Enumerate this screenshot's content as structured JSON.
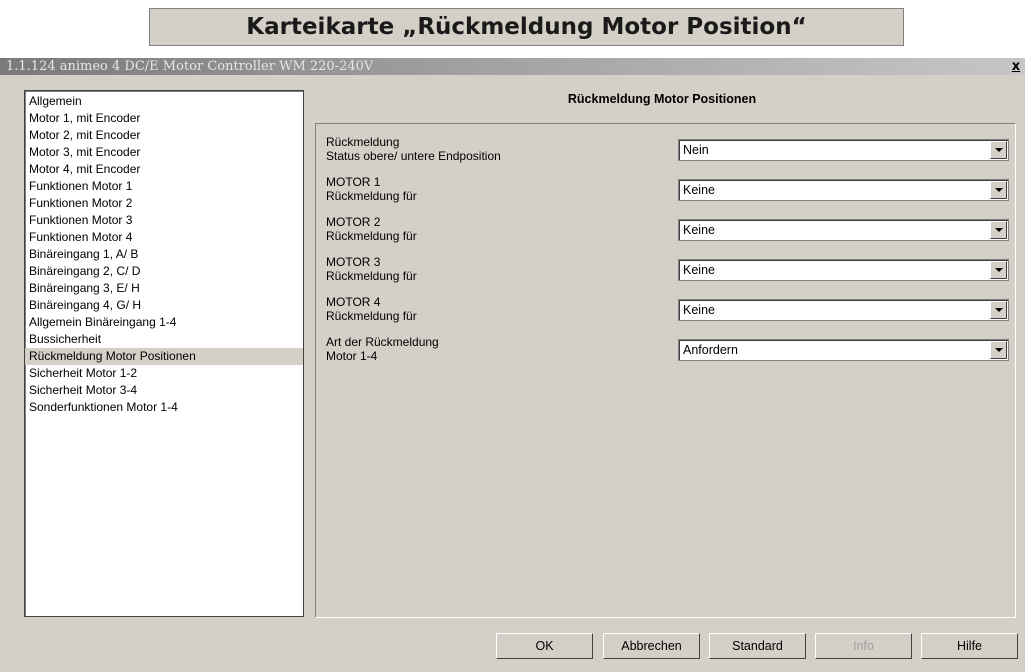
{
  "doc_heading": "Karteikarte „Rückmeldung Motor Position“",
  "window": {
    "title": "1.1.124 animeo 4 DC/E Motor Controller WM 220-240V",
    "close_label": "x"
  },
  "nav": {
    "items": [
      {
        "label": "Allgemein",
        "selected": false
      },
      {
        "label": "Motor 1, mit Encoder",
        "selected": false
      },
      {
        "label": "Motor 2, mit Encoder",
        "selected": false
      },
      {
        "label": "Motor 3, mit Encoder",
        "selected": false
      },
      {
        "label": "Motor 4, mit Encoder",
        "selected": false
      },
      {
        "label": "Funktionen Motor 1",
        "selected": false
      },
      {
        "label": "Funktionen Motor 2",
        "selected": false
      },
      {
        "label": "Funktionen Motor 3",
        "selected": false
      },
      {
        "label": "Funktionen Motor 4",
        "selected": false
      },
      {
        "label": "Binäreingang 1, A/ B",
        "selected": false
      },
      {
        "label": "Binäreingang 2, C/ D",
        "selected": false
      },
      {
        "label": "Binäreingang 3, E/ H",
        "selected": false
      },
      {
        "label": "Binäreingang 4, G/ H",
        "selected": false
      },
      {
        "label": "Allgemein Binäreingang 1-4",
        "selected": false
      },
      {
        "label": "Bussicherheit",
        "selected": false
      },
      {
        "label": "Rückmeldung Motor Positionen",
        "selected": true
      },
      {
        "label": "Sicherheit Motor 1-2",
        "selected": false
      },
      {
        "label": "Sicherheit Motor 3-4",
        "selected": false
      },
      {
        "label": "Sonderfunktionen Motor 1-4",
        "selected": false
      }
    ]
  },
  "panel": {
    "heading": "Rückmeldung Motor Positionen",
    "params": [
      {
        "line1": "Rückmeldung",
        "line2": "Status obere/ untere Endposition",
        "value": "Nein"
      },
      {
        "line1": "MOTOR 1",
        "line2": "Rückmeldung für",
        "value": "Keine"
      },
      {
        "line1": "MOTOR 2",
        "line2": "Rückmeldung für",
        "value": "Keine"
      },
      {
        "line1": "MOTOR 3",
        "line2": "Rückmeldung für",
        "value": "Keine"
      },
      {
        "line1": "MOTOR 4",
        "line2": "Rückmeldung für",
        "value": "Keine"
      },
      {
        "line1": "Art der Rückmeldung",
        "line2": "Motor 1-4",
        "value": "Anfordern"
      }
    ]
  },
  "buttons": {
    "ok": "OK",
    "cancel": "Abbrechen",
    "default": "Standard",
    "info": "Info",
    "help": "Hilfe"
  }
}
